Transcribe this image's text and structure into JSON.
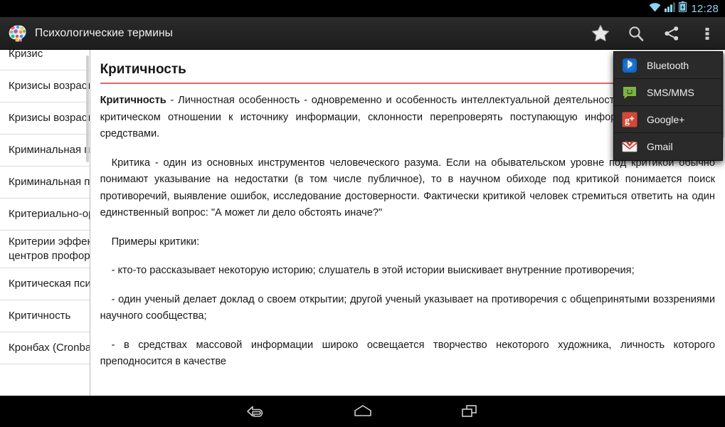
{
  "status_bar": {
    "clock": "12:28",
    "icons": [
      "wifi-icon",
      "cellular-signal-icon",
      "battery-charging-icon"
    ],
    "accent_color": "#8fd3ee"
  },
  "action_bar": {
    "app_icon": "brain-head-icon",
    "title": "Психологические термины",
    "actions": [
      {
        "name": "favorite-star-icon",
        "label": "Избранное"
      },
      {
        "name": "search-icon",
        "label": "Поиск"
      },
      {
        "name": "share-icon",
        "label": "Поделиться"
      },
      {
        "name": "overflow-menu-icon",
        "label": "Ещё"
      }
    ]
  },
  "share_menu": {
    "visible": true,
    "items": [
      {
        "icon": "bluetooth-icon",
        "label": "Bluetooth",
        "color": "#1976d2"
      },
      {
        "icon": "sms-mms-icon",
        "label": "SMS/MMS",
        "color": "#7cb342"
      },
      {
        "icon": "google-plus-icon",
        "label": "Google+",
        "color": "#d34836"
      },
      {
        "icon": "gmail-icon",
        "label": "Gmail",
        "color": "#d93025"
      }
    ]
  },
  "term_list": {
    "items": [
      {
        "label": "Кризис",
        "starred": false
      },
      {
        "label": "Кризисы возрастного развития",
        "starred": false
      },
      {
        "label": "Кризисы возрастные",
        "starred": false
      },
      {
        "label": "Криминальная психология",
        "starred": false
      },
      {
        "label": "Криминальная психопатология",
        "starred": false
      },
      {
        "label": "Критериально-ориентированные тесты",
        "starred": false
      },
      {
        "label": "Критерии эффективности деятельности центров профориентации",
        "starred": false
      },
      {
        "label": "Критическая психология",
        "starred": false
      },
      {
        "label": "Критичность",
        "starred": false
      },
      {
        "label": "Кронбах (Cronbach) Ли",
        "starred": false
      }
    ],
    "star_icon": "star-outline-icon"
  },
  "article": {
    "title": "Критичность",
    "rule_color": "#e36a6a",
    "paragraphs": [
      {
        "lead": "Критичность",
        "text": " - Личностная особенность - одновременно и особенность интеллектуальной деятельности, проявляющаяся в критическом отношении к источнику информации, склонности перепроверять поступающую информацию доступными средствами.",
        "indent": false
      },
      {
        "lead": "",
        "text": "Критика - один из основных инструментов человеческого разума. Если на обывательском уровне под критикой обычно понимают указывание на недостатки (в том числе публичное), то в научном обиходе под критикой понимается поиск противоречий, выявление ошибок, исследование достоверности. Фактически критикой человек стремиться ответить на один единственный вопрос: \"А может ли дело обстоять иначе?\"",
        "indent": true
      },
      {
        "lead": "",
        "text": "Примеры критики:",
        "indent": true
      },
      {
        "lead": "",
        "text": "- кто-то рассказывает некоторую историю; слушатель в этой истории выискивает внутренние противоречия;",
        "indent": true
      },
      {
        "lead": "",
        "text": "- один ученый делает доклад о своем открытии; другой ученый указывает на противоречия с общепринятыми воззрениями научного сообщества;",
        "indent": true
      },
      {
        "lead": "",
        "text": "- в средствах массовой информации широко освещается творчество некоторого художника, личность которого преподносится в качестве",
        "indent": true
      }
    ]
  },
  "nav_bar": {
    "buttons": [
      {
        "icon": "back-icon",
        "label": "Назад"
      },
      {
        "icon": "home-icon",
        "label": "Домой"
      },
      {
        "icon": "recent-apps-icon",
        "label": "Недавние"
      }
    ]
  }
}
